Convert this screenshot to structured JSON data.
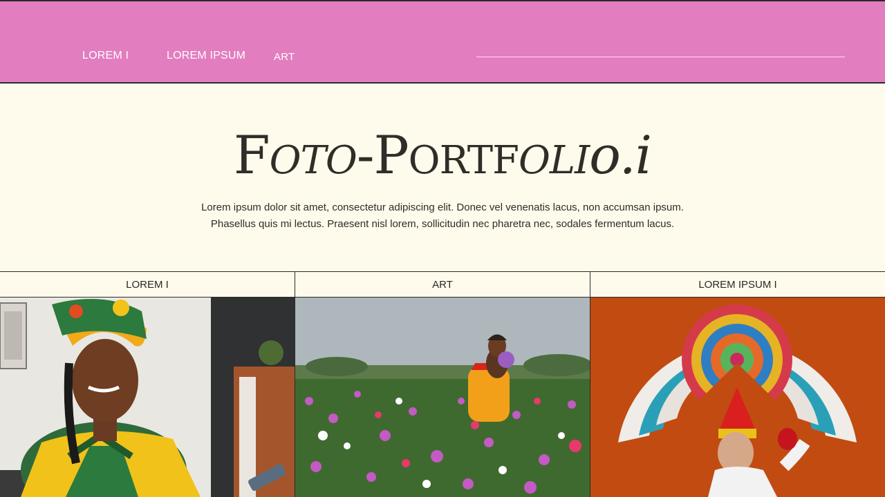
{
  "nav": {
    "items": [
      {
        "label": "LOREM I"
      },
      {
        "label": "LOREM IPSUM"
      },
      {
        "label": "ART"
      }
    ]
  },
  "hero": {
    "title_parts": [
      "F",
      "OTO",
      "-P",
      "ORTF",
      "OLI",
      "O.I"
    ],
    "paragraph_line1": "Lorem ipsum dolor sit amet, consectetur adipiscing elit. Donec vel venenatis lacus, non accumsan ipsum.",
    "paragraph_line2": "Phasellus quis mi lectus. Praesent nisl lorem, sollicitudin nec pharetra nec, sodales fermentum lacus."
  },
  "tabs": [
    {
      "label": "LOREM I"
    },
    {
      "label": "ART"
    },
    {
      "label": "LOREM IPSUM I"
    }
  ],
  "gallery": {
    "photos": [
      {
        "subject": "woman-portrait-photo"
      },
      {
        "subject": "flower-field-photo"
      },
      {
        "subject": "festival-costume-photo"
      }
    ]
  },
  "colors": {
    "header": "#e27dbf",
    "background": "#fefbec",
    "text": "#2b2926"
  }
}
